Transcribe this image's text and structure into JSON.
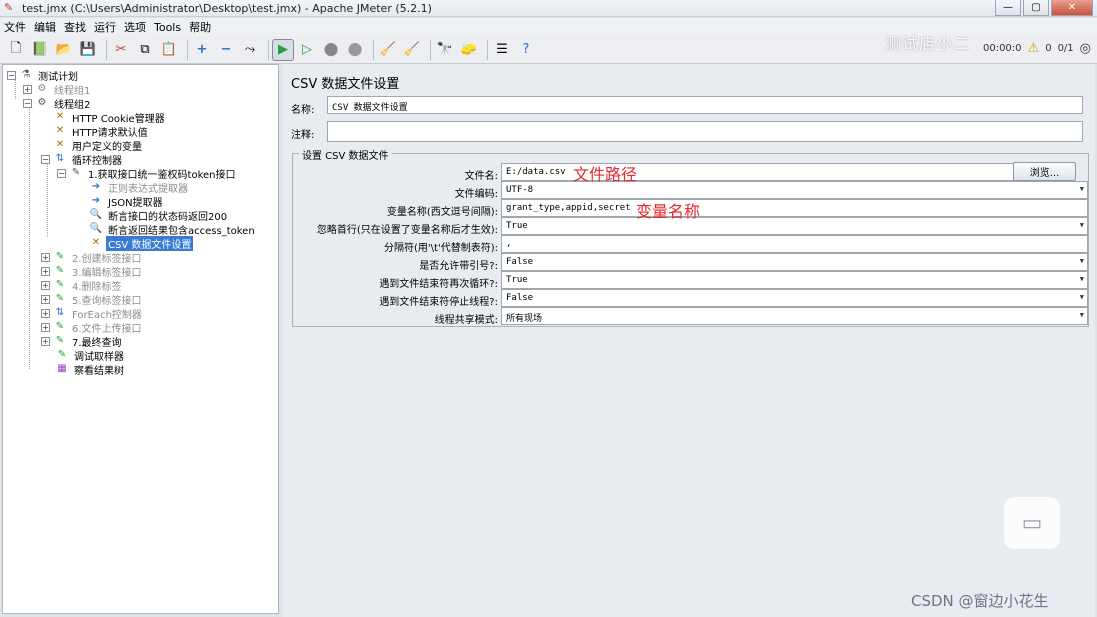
{
  "window": {
    "title": "test.jmx (C:\\Users\\Administrator\\Desktop\\test.jmx) - Apache JMeter (5.2.1)"
  },
  "menu": [
    "文件",
    "编辑",
    "查找",
    "运行",
    "选项",
    "Tools",
    "帮助"
  ],
  "toolbar": {
    "timer": "00:00:0",
    "warnings": "0",
    "threads": "0/1"
  },
  "watermark": "测试店小二",
  "tree": {
    "root": "测试计划",
    "tg1": "线程组1",
    "tg2": "线程组2",
    "cookie": "HTTP Cookie管理器",
    "http_defaults": "HTTP请求默认值",
    "user_vars": "用户定义的变量",
    "loop": "循环控制器",
    "req1": "1.获取接口统一鉴权码token接口",
    "regex": "正则表达式提取器",
    "json": "JSON提取器",
    "assert1": "断言接口的状态码返回200",
    "assert2": "断言返回结果包含access_token",
    "csv": "CSV 数据文件设置",
    "req2": "2.创建标签接口",
    "req3": "3.编辑标签接口",
    "req4": "4.删除标签",
    "req5": "5.查询标签接口",
    "foreach": "ForEach控制器",
    "req6": "6.文件上传接口",
    "req7": "7.最终查询",
    "debug": "调试取样器",
    "result": "察看结果树"
  },
  "panel": {
    "title": "CSV 数据文件设置",
    "name_label": "名称:",
    "name_value": "CSV 数据文件设置",
    "comment_label": "注释:",
    "comment_value": "",
    "group_label": "设置 CSV 数据文件",
    "rows": [
      {
        "label": "文件名:",
        "value": "E:/data.csv"
      },
      {
        "label": "文件编码:",
        "value": "UTF-8"
      },
      {
        "label": "变量名称(西文逗号间隔):",
        "value": "grant_type,appid,secret"
      },
      {
        "label": "忽略首行(只在设置了变量名称后才生效):",
        "value": "True"
      },
      {
        "label": "分隔符(用'\\t'代替制表符):",
        "value": ","
      },
      {
        "label": "是否允许带引号?:",
        "value": "False"
      },
      {
        "label": "遇到文件结束符再次循环?:",
        "value": "True"
      },
      {
        "label": "遇到文件结束符停止线程?:",
        "value": "False"
      },
      {
        "label": "线程共享模式:",
        "value": "所有现场"
      }
    ],
    "browse": "浏览..."
  },
  "annotations": {
    "file_path": "文件路径",
    "var_names": "变量名称"
  },
  "footer": {
    "csdn": "CSDN @窗边小花生"
  }
}
